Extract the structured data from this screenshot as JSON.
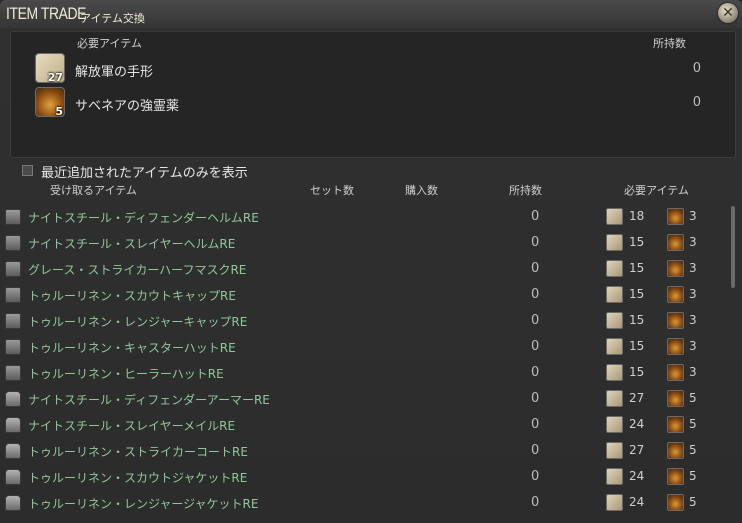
{
  "window": {
    "title_en": "ITEM TRADE",
    "title_jp": "アイテム交換",
    "close_icon": "close-icon"
  },
  "requirements": {
    "header_left": "必要アイテム",
    "header_right": "所持数",
    "items": [
      {
        "name": "解放軍の手形",
        "count": "27",
        "owned": "0",
        "icon": "letter-icon"
      },
      {
        "name": "サベネアの強霊薬",
        "count": "5",
        "owned": "0",
        "icon": "potion-icon"
      }
    ]
  },
  "filter": {
    "label": "最近追加されたアイテムのみを表示",
    "checked": false
  },
  "columns": {
    "receive": "受け取るアイテム",
    "set_count": "セット数",
    "purchase_count": "購入数",
    "owned": "所持数",
    "required": "必要アイテム"
  },
  "rows": [
    {
      "name": "ナイトスチール・ディフェンダーヘルムRE",
      "owned": "0",
      "need_a": "18",
      "need_b": "3",
      "icon": "head"
    },
    {
      "name": "ナイトスチール・スレイヤーヘルムRE",
      "owned": "0",
      "need_a": "15",
      "need_b": "3",
      "icon": "head"
    },
    {
      "name": "グレース・ストライカーハーフマスクRE",
      "owned": "0",
      "need_a": "15",
      "need_b": "3",
      "icon": "head"
    },
    {
      "name": "トゥルーリネン・スカウトキャップRE",
      "owned": "0",
      "need_a": "15",
      "need_b": "3",
      "icon": "head"
    },
    {
      "name": "トゥルーリネン・レンジャーキャップRE",
      "owned": "0",
      "need_a": "15",
      "need_b": "3",
      "icon": "head"
    },
    {
      "name": "トゥルーリネン・キャスターハットRE",
      "owned": "0",
      "need_a": "15",
      "need_b": "3",
      "icon": "head"
    },
    {
      "name": "トゥルーリネン・ヒーラーハットRE",
      "owned": "0",
      "need_a": "15",
      "need_b": "3",
      "icon": "head"
    },
    {
      "name": "ナイトスチール・ディフェンダーアーマーRE",
      "owned": "0",
      "need_a": "27",
      "need_b": "5",
      "icon": "body"
    },
    {
      "name": "ナイトスチール・スレイヤーメイルRE",
      "owned": "0",
      "need_a": "24",
      "need_b": "5",
      "icon": "body"
    },
    {
      "name": "トゥルーリネン・ストライカーコートRE",
      "owned": "0",
      "need_a": "27",
      "need_b": "5",
      "icon": "body"
    },
    {
      "name": "トゥルーリネン・スカウトジャケットRE",
      "owned": "0",
      "need_a": "24",
      "need_b": "5",
      "icon": "body"
    },
    {
      "name": "トゥルーリネン・レンジャージャケットRE",
      "owned": "0",
      "need_a": "24",
      "need_b": "5",
      "icon": "body"
    }
  ]
}
